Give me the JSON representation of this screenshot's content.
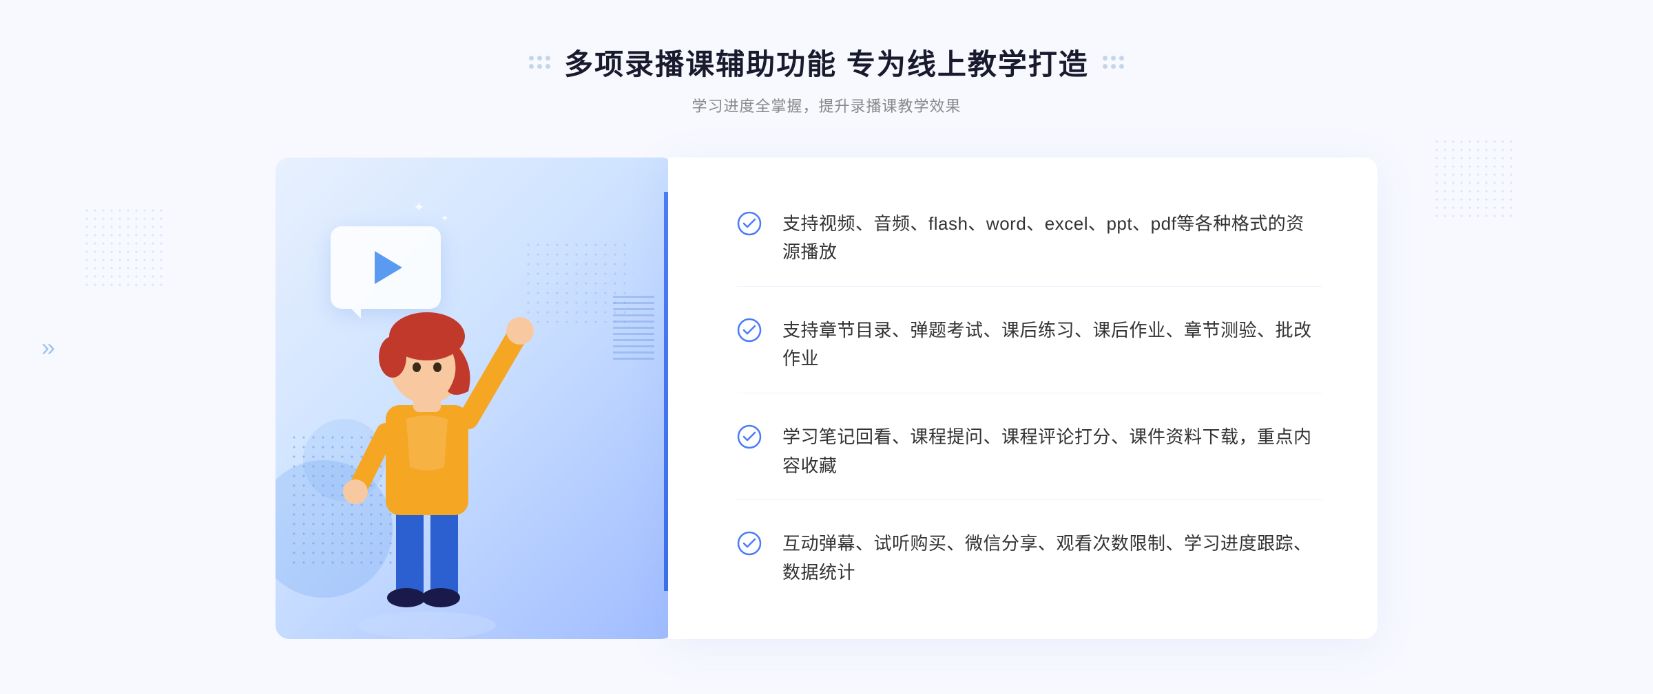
{
  "page": {
    "background": "#f8f9ff"
  },
  "header": {
    "main_title": "多项录播课辅助功能 专为线上教学打造",
    "subtitle": "学习进度全掌握，提升录播课教学效果"
  },
  "features": [
    {
      "id": 1,
      "text": "支持视频、音频、flash、word、excel、ppt、pdf等各种格式的资源播放"
    },
    {
      "id": 2,
      "text": "支持章节目录、弹题考试、课后练习、课后作业、章节测验、批改作业"
    },
    {
      "id": 3,
      "text": "学习笔记回看、课程提问、课程评论打分、课件资料下载，重点内容收藏"
    },
    {
      "id": 4,
      "text": "互动弹幕、试听购买、微信分享、观看次数限制、学习进度跟踪、数据统计"
    }
  ],
  "icons": {
    "check": "check-circle",
    "play": "play-triangle",
    "chevron": "»"
  },
  "colors": {
    "accent_blue": "#4a7cf7",
    "light_blue": "#a0bcff",
    "text_dark": "#1a1a2e",
    "text_gray": "#888888",
    "text_body": "#333333",
    "bg_light": "#f8f9ff",
    "white": "#ffffff"
  }
}
